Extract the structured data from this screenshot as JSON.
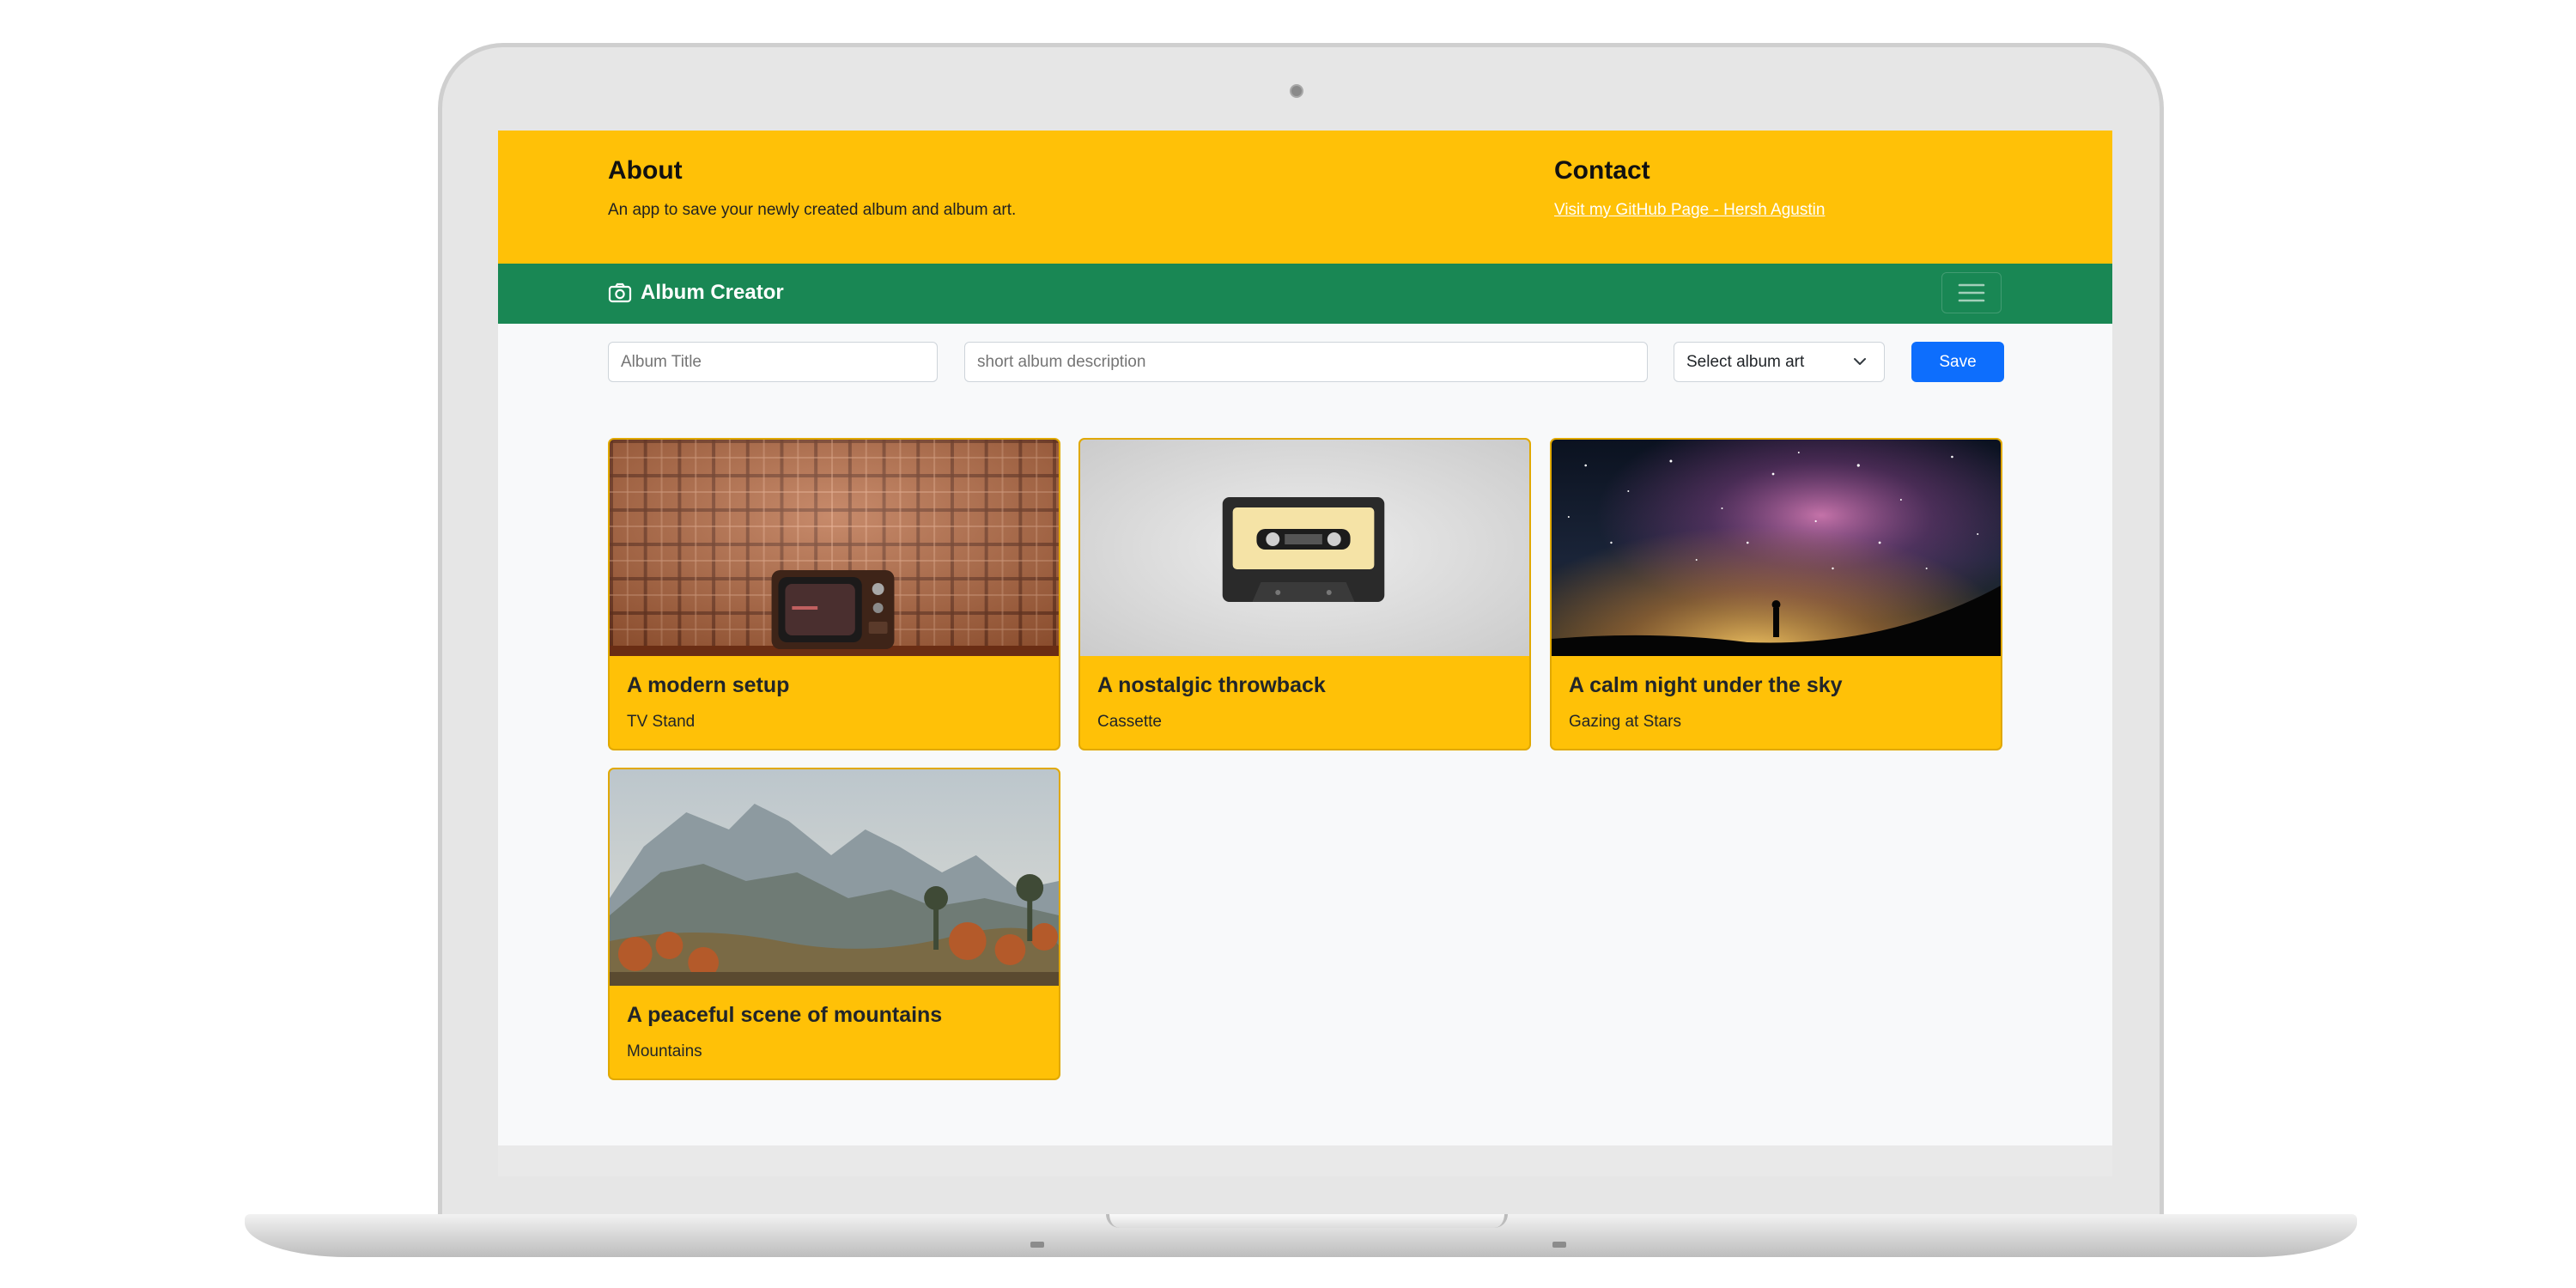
{
  "about": {
    "heading": "About",
    "text": "An app to save your newly created album and album art."
  },
  "contact": {
    "heading": "Contact",
    "link": "Visit my GitHub Page - Hersh Agustin"
  },
  "navbar": {
    "brand": "Album Creator",
    "brand_icon": "camera-icon",
    "toggle_icon": "hamburger-icon"
  },
  "form": {
    "title_placeholder": "Album Title",
    "description_placeholder": "short album description",
    "select_value": "Select album art",
    "save_label": "Save"
  },
  "albums": [
    {
      "title": "A modern setup",
      "subtitle": "TV Stand",
      "art": "tv-stand-image"
    },
    {
      "title": "A nostalgic throwback",
      "subtitle": "Cassette",
      "art": "cassette-image"
    },
    {
      "title": "A calm night under the sky",
      "subtitle": "Gazing at Stars",
      "art": "stars-image"
    },
    {
      "title": "A peaceful scene of mountains",
      "subtitle": "Mountains",
      "art": "mountains-image"
    }
  ],
  "colors": {
    "header_yellow": "#ffc107",
    "navbar_green": "#198754",
    "primary_blue": "#0d6efd",
    "page_bg": "#f8f9fa"
  }
}
